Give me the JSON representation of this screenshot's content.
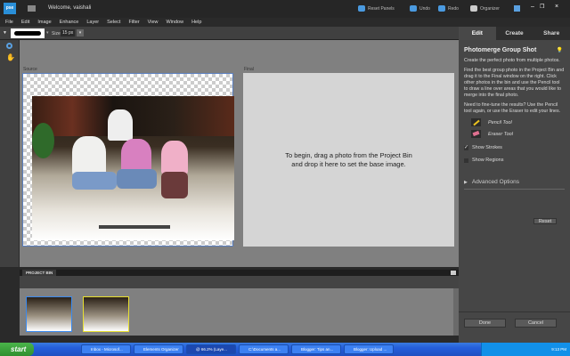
{
  "title": {
    "logo": "pse",
    "welcome": "Welcome, vaishali",
    "reset_panels": "Reset Panels",
    "undo": "Undo",
    "redo": "Redo",
    "organizer": "Organizer"
  },
  "menu": [
    "File",
    "Edit",
    "Image",
    "Enhance",
    "Layer",
    "Select",
    "Filter",
    "View",
    "Window",
    "Help"
  ],
  "options": {
    "size_label": "Size:",
    "size_value": "15 px"
  },
  "tabs": [
    "Edit",
    "Create",
    "Share"
  ],
  "canvas": {
    "source_label": "Source",
    "final_label": "Final",
    "final_hint": "To begin, drag a photo from the Project Bin and drop it here to set the base image."
  },
  "bin": {
    "title": "PROJECT BIN"
  },
  "panel": {
    "title": "Photomerge Group Shot",
    "p1": "Create the perfect photo from multiple photos.",
    "p2": "Find the best group photo in the Project Bin and drag it to the Final window on the right. Click other photos in the bin and use the Pencil tool to draw a line over areas that you would like to merge into the final photo.",
    "p3": "Need to fine-tune the results? Use the Pencil tool again, or use the Eraser to edit your lines.",
    "pencil": "Pencil Tool",
    "eraser": "Eraser Tool",
    "show_strokes": "Show Strokes",
    "show_strokes_checked": true,
    "show_regions": "Show Regions",
    "show_regions_checked": false,
    "advanced": "Advanced Options",
    "reset": "Reset",
    "done": "Done",
    "cancel": "Cancel"
  },
  "taskbar": {
    "start": "start",
    "tasks": [
      "Inbox - Microsof...",
      "Elements Organizer",
      "@ 66.2% (Laye...",
      "C:\\Documents a...",
      "Blogger: Tips an...",
      "Blogger: Upload ..."
    ],
    "clock": "9:13 PM"
  }
}
